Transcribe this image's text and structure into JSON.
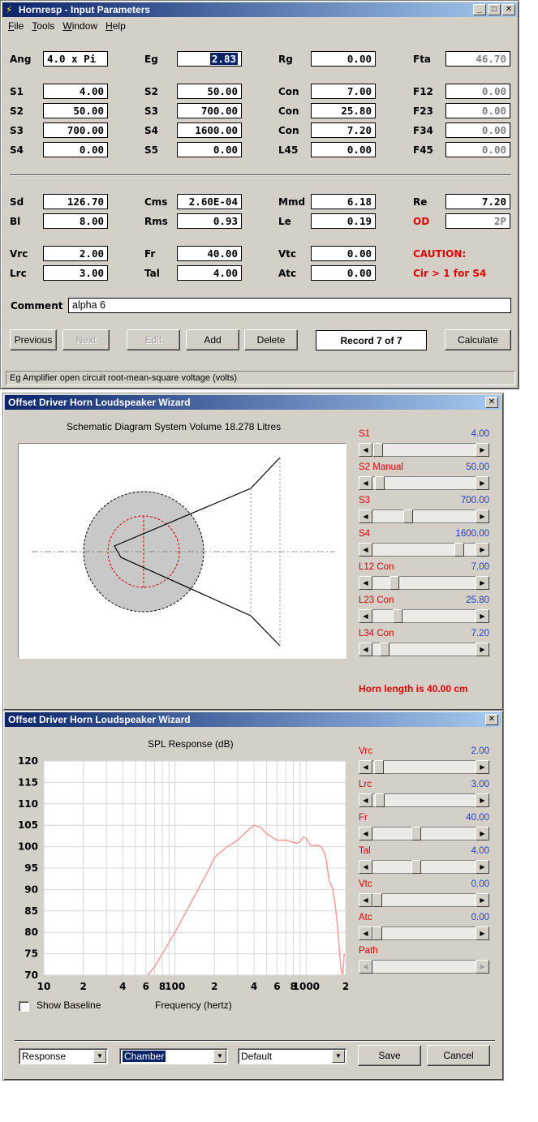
{
  "main": {
    "title": "Hornresp - Input Parameters",
    "menu": [
      "File",
      "Tools",
      "Window",
      "Help"
    ],
    "params": {
      "ang": {
        "label": "Ang",
        "value": "4.0 x Pi"
      },
      "eg": {
        "label": "Eg",
        "value": "2.83"
      },
      "rg": {
        "label": "Rg",
        "value": "0.00"
      },
      "fta": {
        "label": "Fta",
        "value": "46.70"
      },
      "s1a": {
        "label": "S1",
        "value": "4.00"
      },
      "s2a": {
        "label": "S2",
        "value": "50.00"
      },
      "con1": {
        "label": "Con",
        "value": "7.00"
      },
      "f12": {
        "label": "F12",
        "value": "0.00"
      },
      "s2b": {
        "label": "S2",
        "value": "50.00"
      },
      "s3a": {
        "label": "S3",
        "value": "700.00"
      },
      "con2": {
        "label": "Con",
        "value": "25.80"
      },
      "f23": {
        "label": "F23",
        "value": "0.00"
      },
      "s3b": {
        "label": "S3",
        "value": "700.00"
      },
      "s4a": {
        "label": "S4",
        "value": "1600.00"
      },
      "con3": {
        "label": "Con",
        "value": "7.20"
      },
      "f34": {
        "label": "F34",
        "value": "0.00"
      },
      "s4b": {
        "label": "S4",
        "value": "0.00"
      },
      "s5": {
        "label": "S5",
        "value": "0.00"
      },
      "l45": {
        "label": "L45",
        "value": "0.00"
      },
      "f45": {
        "label": "F45",
        "value": "0.00"
      },
      "sd": {
        "label": "Sd",
        "value": "126.70"
      },
      "cms": {
        "label": "Cms",
        "value": "2.60E-04"
      },
      "mmd": {
        "label": "Mmd",
        "value": "6.18"
      },
      "re": {
        "label": "Re",
        "value": "7.20"
      },
      "bl": {
        "label": "Bl",
        "value": "8.00"
      },
      "rms": {
        "label": "Rms",
        "value": "0.93"
      },
      "le": {
        "label": "Le",
        "value": "0.19"
      },
      "od": {
        "label": "OD",
        "value": "2P"
      },
      "vrc": {
        "label": "Vrc",
        "value": "2.00"
      },
      "fr": {
        "label": "Fr",
        "value": "40.00"
      },
      "vtc": {
        "label": "Vtc",
        "value": "0.00"
      },
      "lrc": {
        "label": "Lrc",
        "value": "3.00"
      },
      "tal": {
        "label": "Tal",
        "value": "4.00"
      },
      "atc": {
        "label": "Atc",
        "value": "0.00"
      }
    },
    "caution_title": "CAUTION:",
    "caution_text": "Cir > 1 for S4",
    "comment_label": "Comment",
    "comment_value": "alpha 6",
    "buttons": {
      "previous": "Previous",
      "next": "Next",
      "edit": "Edit",
      "add": "Add",
      "delete": "Delete",
      "record": "Record 7 of 7",
      "calculate": "Calculate"
    },
    "status": "Eg  Amplifier open circuit root-mean-square voltage  (volts)"
  },
  "wizard1": {
    "title": "Offset Driver Horn Loudspeaker Wizard",
    "diagram_caption": "Schematic Diagram   System Volume 18.278 Litres",
    "sliders": [
      {
        "label": "S1",
        "value": "4.00",
        "pos": 0.01
      },
      {
        "label": "S2  Manual",
        "value": "50.00",
        "pos": 0.03
      },
      {
        "label": "S3",
        "value": "700.00",
        "pos": 0.33
      },
      {
        "label": "S4",
        "value": "1600.00",
        "pos": 0.88
      },
      {
        "label": "L12  Con",
        "value": "7.00",
        "pos": 0.18
      },
      {
        "label": "L23  Con",
        "value": "25.80",
        "pos": 0.22
      },
      {
        "label": "L34  Con",
        "value": "7.20",
        "pos": 0.08
      }
    ],
    "horn_length": "Horn length is 40.00 cm"
  },
  "wizard2": {
    "title": "Offset Driver Horn Loudspeaker Wizard",
    "sliders": [
      {
        "label": "Vrc",
        "value": "2.00",
        "pos": 0.02
      },
      {
        "label": "Lrc",
        "value": "3.00",
        "pos": 0.03
      },
      {
        "label": "Fr",
        "value": "40.00",
        "pos": 0.42
      },
      {
        "label": "Tal",
        "value": "4.00",
        "pos": 0.42
      },
      {
        "label": "Vtc",
        "value": "0.00",
        "pos": 0.0
      },
      {
        "label": "Atc",
        "value": "0.00",
        "pos": 0.0
      },
      {
        "label": "Path",
        "value": "",
        "pos": -1
      }
    ],
    "show_baseline": "Show Baseline",
    "dropdowns": {
      "response": "Response",
      "chamber": "Chamber",
      "default": "Default"
    },
    "buttons": {
      "save": "Save",
      "cancel": "Cancel"
    }
  },
  "chart_data": {
    "type": "line",
    "title": "SPL Response (dB)",
    "xlabel": "Frequency (hertz)",
    "ylabel": "",
    "x_scale": "log",
    "xlim": [
      10,
      2000
    ],
    "ylim": [
      70,
      120
    ],
    "x_tick_labels": [
      "10",
      "2",
      "4",
      "6",
      "8",
      "100",
      "2",
      "4",
      "6",
      "8",
      "1000",
      "2"
    ],
    "y_tick_labels": [
      "120",
      "115",
      "110",
      "105",
      "100",
      "95",
      "90",
      "85",
      "80",
      "75",
      "70"
    ],
    "grid": true,
    "color": "#f4a0a0",
    "series": [
      {
        "x": [
          62,
          70,
          80,
          100,
          120,
          150,
          180,
          200,
          250,
          300,
          350,
          400,
          450,
          500,
          600,
          700,
          800,
          850,
          900,
          950,
          1000,
          1050,
          1100,
          1150,
          1200,
          1300,
          1400,
          1500,
          1600,
          1650,
          1700,
          1750,
          1800,
          1850,
          1900,
          1950
        ],
        "y": [
          70,
          72,
          75,
          80,
          84.5,
          90,
          94.5,
          97.5,
          100,
          101.5,
          103.5,
          105,
          104.5,
          103,
          101.5,
          101.5,
          101,
          100.8,
          101.2,
          102.2,
          102,
          100.8,
          100.2,
          100.2,
          100.4,
          100,
          98,
          92,
          90,
          87,
          84,
          80,
          75,
          71,
          70,
          75
        ]
      }
    ]
  }
}
